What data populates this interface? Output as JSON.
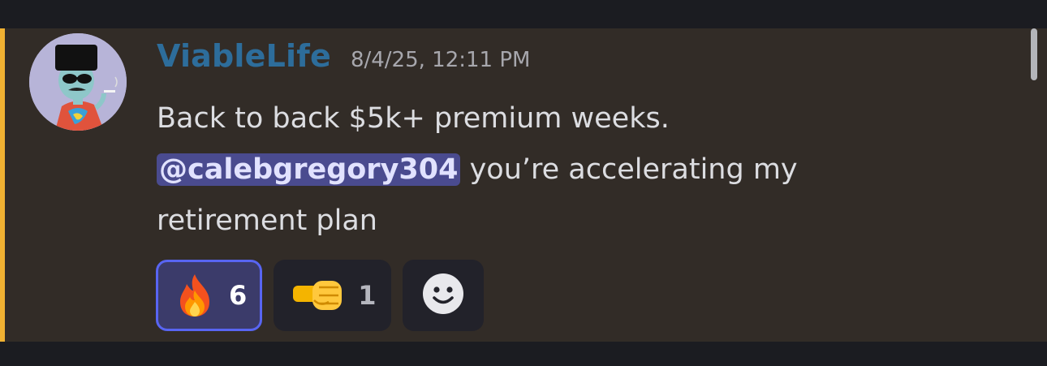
{
  "message": {
    "author": "ViableLife",
    "timestamp": "8/4/25, 12:11 PM",
    "content": {
      "line1": "Back to back $5k+ premium weeks.",
      "mention": "@calebgregory304",
      "line2_rest": " you’re accelerating my",
      "line3": "retirement plan"
    },
    "reactions": [
      {
        "emoji": "fire-emoji",
        "count": "6",
        "selected": true
      },
      {
        "emoji": "left-facing-fist-emoji",
        "count": "1",
        "selected": false
      }
    ],
    "add_reaction_icon": "smiley-add-reaction-icon"
  },
  "colors": {
    "username": "#2d6d9b",
    "mention_bg": "#4a4b8f",
    "highlight_bar": "#f0b132",
    "message_bg": "#322c27",
    "selected_reaction_border": "#5865f2"
  }
}
